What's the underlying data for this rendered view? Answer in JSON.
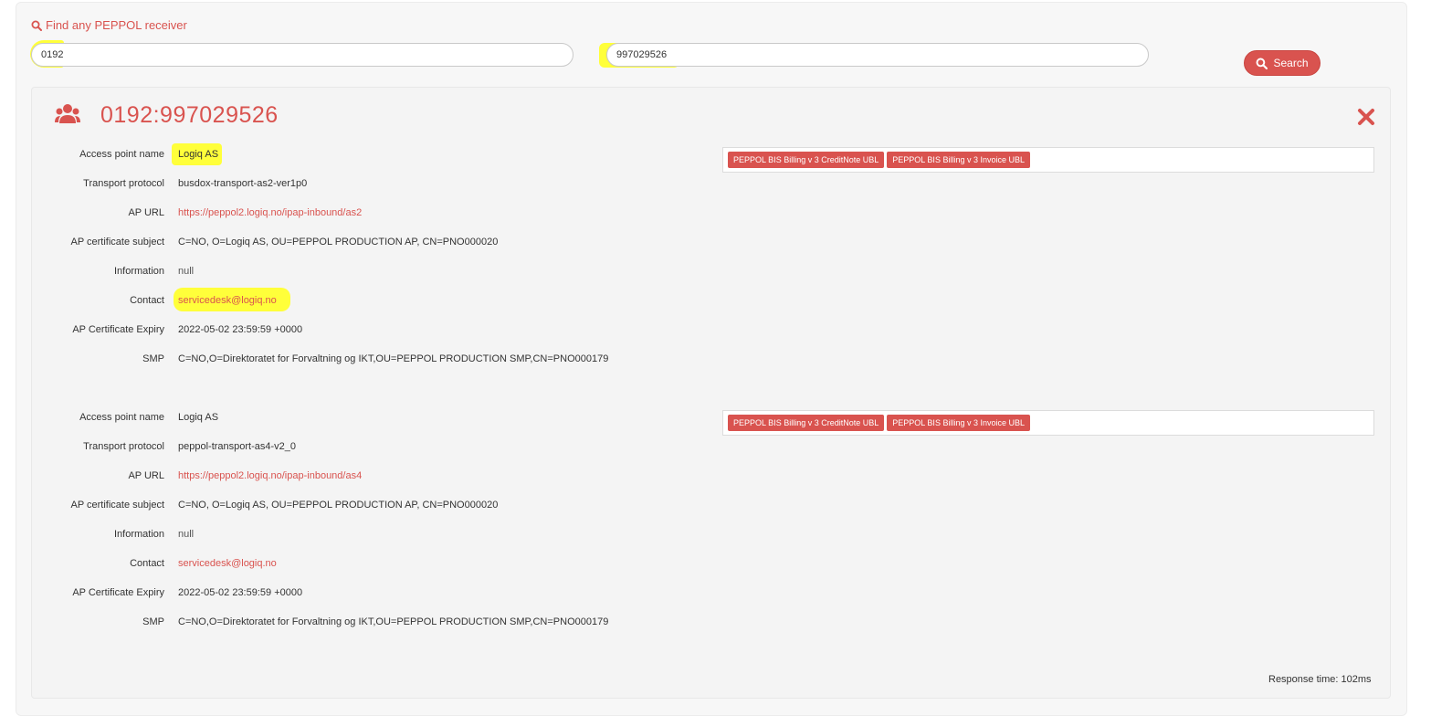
{
  "search": {
    "title": "Find any PEPPOL receiver",
    "scheme_value": "0192",
    "id_value": "997029526",
    "button_label": "Search"
  },
  "result": {
    "title": "0192:997029526",
    "entries": [
      {
        "access_point_name_label": "Access point name",
        "access_point_name": "Logiq AS",
        "transport_protocol_label": "Transport protocol",
        "transport_protocol": "busdox-transport-as2-ver1p0",
        "ap_url_label": "AP URL",
        "ap_url": "https://peppol2.logiq.no/ipap-inbound/as2",
        "ap_cert_subject_label": "AP certificate subject",
        "ap_cert_subject": "C=NO, O=Logiq AS, OU=PEPPOL PRODUCTION AP, CN=PNO000020",
        "information_label": "Information",
        "information": "null",
        "contact_label": "Contact",
        "contact": "servicedesk@logiq.no",
        "ap_cert_expiry_label": "AP Certificate Expiry",
        "ap_cert_expiry": "2022-05-02 23:59:59 +0000",
        "smp_label": "SMP",
        "smp": "C=NO,O=Direktoratet for Forvaltning og IKT,OU=PEPPOL PRODUCTION SMP,CN=PNO000179",
        "documents": [
          "PEPPOL BIS Billing v 3 CreditNote UBL",
          "PEPPOL BIS Billing v 3 Invoice UBL"
        ]
      },
      {
        "access_point_name_label": "Access point name",
        "access_point_name": "Logiq AS",
        "transport_protocol_label": "Transport protocol",
        "transport_protocol": "peppol-transport-as4-v2_0",
        "ap_url_label": "AP URL",
        "ap_url": "https://peppol2.logiq.no/ipap-inbound/as4",
        "ap_cert_subject_label": "AP certificate subject",
        "ap_cert_subject": "C=NO, O=Logiq AS, OU=PEPPOL PRODUCTION AP, CN=PNO000020",
        "information_label": "Information",
        "information": "null",
        "contact_label": "Contact",
        "contact": "servicedesk@logiq.no",
        "ap_cert_expiry_label": "AP Certificate Expiry",
        "ap_cert_expiry": "2022-05-02 23:59:59 +0000",
        "smp_label": "SMP",
        "smp": "C=NO,O=Direktoratet for Forvaltning og IKT,OU=PEPPOL PRODUCTION SMP,CN=PNO000179",
        "documents": [
          "PEPPOL BIS Billing v 3 CreditNote UBL",
          "PEPPOL BIS Billing v 3 Invoice UBL"
        ]
      }
    ],
    "response_time": "Response time: 102ms"
  },
  "colors": {
    "accent": "#d9534f",
    "highlight": "#ffff3a"
  },
  "icons": [
    "search-icon",
    "users-icon",
    "close-icon"
  ]
}
